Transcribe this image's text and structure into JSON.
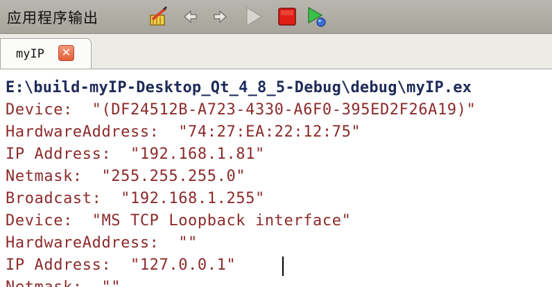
{
  "panel": {
    "title": "应用程序输出"
  },
  "toolbar": {
    "icons": [
      {
        "name": "clean-output-icon"
      },
      {
        "name": "previous-icon"
      },
      {
        "name": "next-icon"
      },
      {
        "name": "run-icon"
      },
      {
        "name": "stop-icon"
      },
      {
        "name": "debug-run-icon"
      }
    ]
  },
  "tab": {
    "label": "myIP",
    "close_glyph": "✕"
  },
  "output": {
    "lines": [
      "E:\\build-myIP-Desktop_Qt_4_8_5-Debug\\debug\\myIP.ex",
      "Device:  \"(DF24512B-A723-4330-A6F0-395ED2F26A19)\"",
      "HardwareAddress:  \"74:27:EA:22:12:75\"",
      "IP Address:  \"192.168.1.81\"",
      "Netmask:  \"255.255.255.0\"",
      "Broadcast:  \"192.168.1.255\"",
      "Device:  \"MS TCP Loopback interface\"",
      "HardwareAddress:  \"\"",
      "IP Address:  \"127.0.0.1\"",
      "Netmask:  \"\""
    ]
  },
  "colors": {
    "toolbar_bg": "#b0ada5",
    "output_text": "#8c2a2a",
    "path_text": "#1e2a5a",
    "close_button": "#e8683f"
  }
}
